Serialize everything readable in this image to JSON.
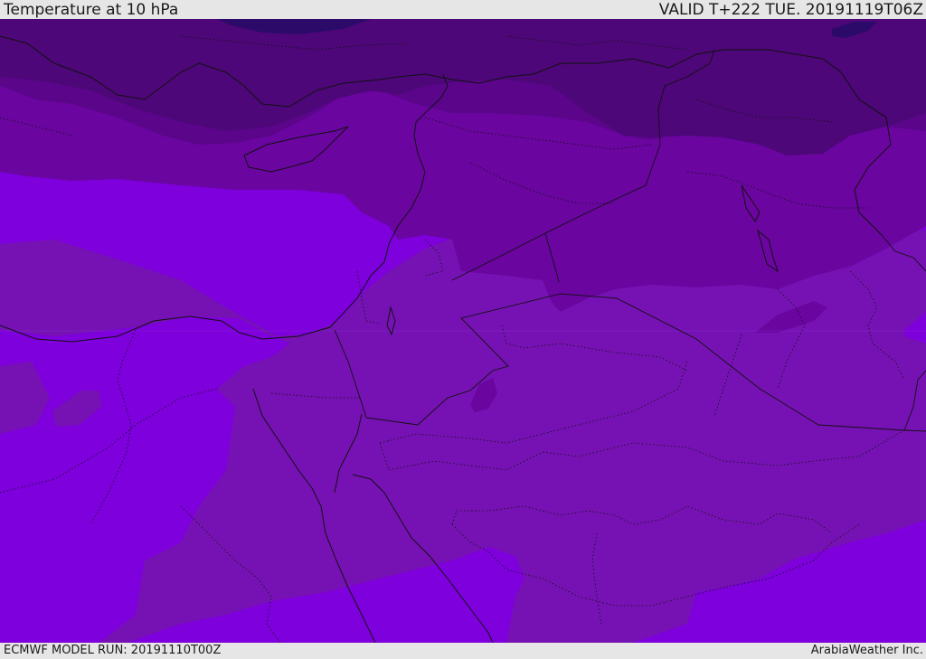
{
  "header": {
    "title": "Temperature at 10 hPa",
    "valid": "VALID T+222 TUE. 20191119T06Z"
  },
  "footer": {
    "model_run": "ECMWF MODEL RUN: 20191110T00Z",
    "credit": "ArabiaWeather Inc."
  },
  "colors": {
    "band_darkest": "#2b0a6a",
    "band_1": "#4d0778",
    "band_2": "#5a058a",
    "band_3": "#6a05a0",
    "band_4": "#7612b3",
    "band_5": "#7e00dc",
    "borders": "#111111"
  }
}
